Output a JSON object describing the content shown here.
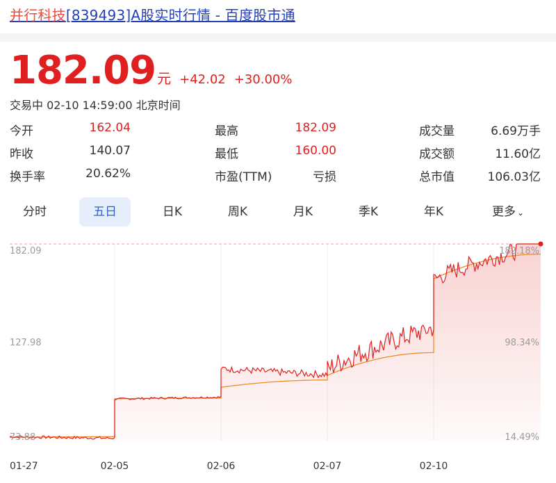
{
  "header": {
    "title_name": "并行科技",
    "title_rest": "[839493]A股实时行情 - 百度股市通"
  },
  "quote": {
    "price": "182.09",
    "unit": "元",
    "change": "+42.02",
    "change_pct": "+30.00%",
    "status": "交易中 02-10 14:59:00 北京时间"
  },
  "stats": [
    {
      "label": "今开",
      "value": "162.04",
      "color": "red"
    },
    {
      "label": "最高",
      "value": "182.09",
      "color": "red"
    },
    {
      "label": "成交量",
      "value": "6.69万手",
      "color": "dark"
    },
    {
      "label": "昨收",
      "value": "140.07",
      "color": "dark"
    },
    {
      "label": "最低",
      "value": "160.00",
      "color": "red"
    },
    {
      "label": "成交额",
      "value": "11.60亿",
      "color": "dark"
    },
    {
      "label": "换手率",
      "value": "20.62%",
      "color": "dark"
    },
    {
      "label": "市盈(TTM)",
      "value": "亏损",
      "color": "dark"
    },
    {
      "label": "总市值",
      "value": "106.03亿",
      "color": "dark"
    }
  ],
  "tabs": [
    {
      "label": "分时",
      "active": false
    },
    {
      "label": "五日",
      "active": true
    },
    {
      "label": "日K",
      "active": false
    },
    {
      "label": "周K",
      "active": false
    },
    {
      "label": "月K",
      "active": false
    },
    {
      "label": "季K",
      "active": false
    },
    {
      "label": "年K",
      "active": false
    },
    {
      "label": "更多",
      "active": false
    }
  ],
  "colors": {
    "up": "#e02020",
    "avg_line": "#f08a24",
    "link": "#2440b3",
    "tab_active_bg": "#e6eefb",
    "tab_active_text": "#2a62d8"
  },
  "chart_data": {
    "type": "line",
    "y_left_ticks": [
      "182.09",
      "127.98",
      "73.88"
    ],
    "y_right_ticks": [
      "182.18%",
      "98.34%",
      "14.49%"
    ],
    "x_ticks": [
      "01-27",
      "02-05",
      "02-06",
      "02-07",
      "02-10"
    ],
    "ylim": [
      73.88,
      182.09
    ],
    "days": [
      {
        "date": "01-27",
        "open": 76.5,
        "close": 75.6,
        "low": 74.0,
        "high": 77.5,
        "avg_start": 76.0,
        "avg_end": 76.4
      },
      {
        "date": "02-05",
        "open": 97.0,
        "close": 98.1,
        "low": 96.5,
        "high": 99.0,
        "avg_start": 97.2,
        "avg_end": 97.6
      },
      {
        "date": "02-06",
        "open": 114.0,
        "close": 110.4,
        "low": 106.0,
        "high": 114.5,
        "avg_start": 103.5,
        "avg_end": 107.5
      },
      {
        "date": "02-07",
        "open": 113.0,
        "close": 136.3,
        "low": 111.0,
        "high": 137.5,
        "avg_start": 110.0,
        "avg_end": 122.5
      },
      {
        "date": "02-10",
        "open": 162.04,
        "close": 182.09,
        "low": 160.0,
        "high": 182.09,
        "avg_start": 163.0,
        "avg_end": 176.5
      }
    ]
  }
}
